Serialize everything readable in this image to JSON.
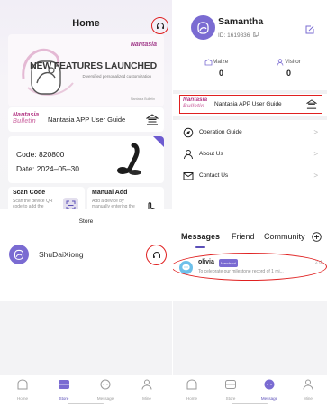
{
  "home": {
    "title": "Home",
    "banner": {
      "brand": "Nantasia",
      "headline": "NEW FEATURES LAUNCHED",
      "subtitle": "Diversified personalized customization",
      "footer": "Nantasia Bulletin"
    },
    "guide_card": {
      "logo_line1": "Nantasia",
      "logo_line2": "Bulletin",
      "label": "Nantasia APP User Guide"
    },
    "device_card": {
      "code": "Code: 820800",
      "date": "Date: 2024–05–30"
    },
    "scan_code": {
      "title": "Scan Code",
      "description": "Scan the device QR code to add the device"
    },
    "manual_add": {
      "title": "Manual Add",
      "description": "Add a device by manually entering the device code"
    }
  },
  "profile": {
    "name": "Samantha",
    "id": "ID: 1619836",
    "stats": [
      {
        "label": "Maize",
        "value": "0"
      },
      {
        "label": "Visitor",
        "value": "0"
      }
    ],
    "guide_card": {
      "logo_line1": "Nantasia",
      "logo_line2": "Bulletin",
      "label": "Nantasia APP User Guide"
    },
    "menu": [
      {
        "label": "Operation Guide",
        "icon": "compass-icon"
      },
      {
        "label": "About Us",
        "icon": "person-icon"
      },
      {
        "label": "Contact Us",
        "icon": "mail-icon"
      }
    ]
  },
  "store": {
    "title": "Store",
    "username": "ShuDaiXiong"
  },
  "messages": {
    "tabs": [
      "Messages",
      "Friend",
      "Community"
    ],
    "item": {
      "name": "olivia",
      "badge": "Merchant",
      "time": "2 d",
      "preview": "To celebrate our milestone record of 1 mi..."
    }
  },
  "tabbar": [
    "Home",
    "Store",
    "Message",
    "Mine"
  ],
  "colors": {
    "accent": "#6d5bd0",
    "brand_pink": "#b43a86",
    "highlight_red": "#e02020"
  }
}
